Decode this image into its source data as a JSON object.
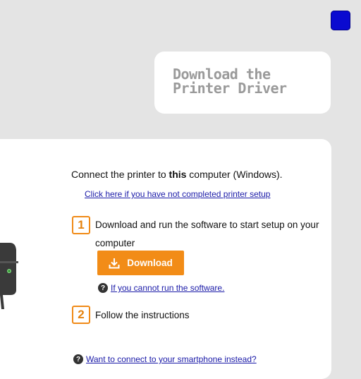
{
  "header": {
    "title": "Download the Printer Driver"
  },
  "main": {
    "connect_prefix": "Connect the printer to ",
    "connect_bold": "this",
    "connect_suffix": " computer (Windows).",
    "setup_link": "Click here if you have not completed printer setup",
    "steps": [
      {
        "number": "1",
        "text": "Download and run the software to start setup on your computer"
      },
      {
        "number": "2",
        "text": "Follow the instructions"
      }
    ],
    "download_label": "Download",
    "cannot_run_link": "If you cannot run the software.",
    "smartphone_link": "Want to connect to your smartphone instead?"
  },
  "icons": {
    "corner": "blue-square-icon",
    "download": "download-icon",
    "help": "question-icon",
    "printer": "printer-illustration"
  },
  "colors": {
    "accent": "#f28c17",
    "link": "#1a1aa8",
    "corner_square": "#0a0ad0"
  }
}
